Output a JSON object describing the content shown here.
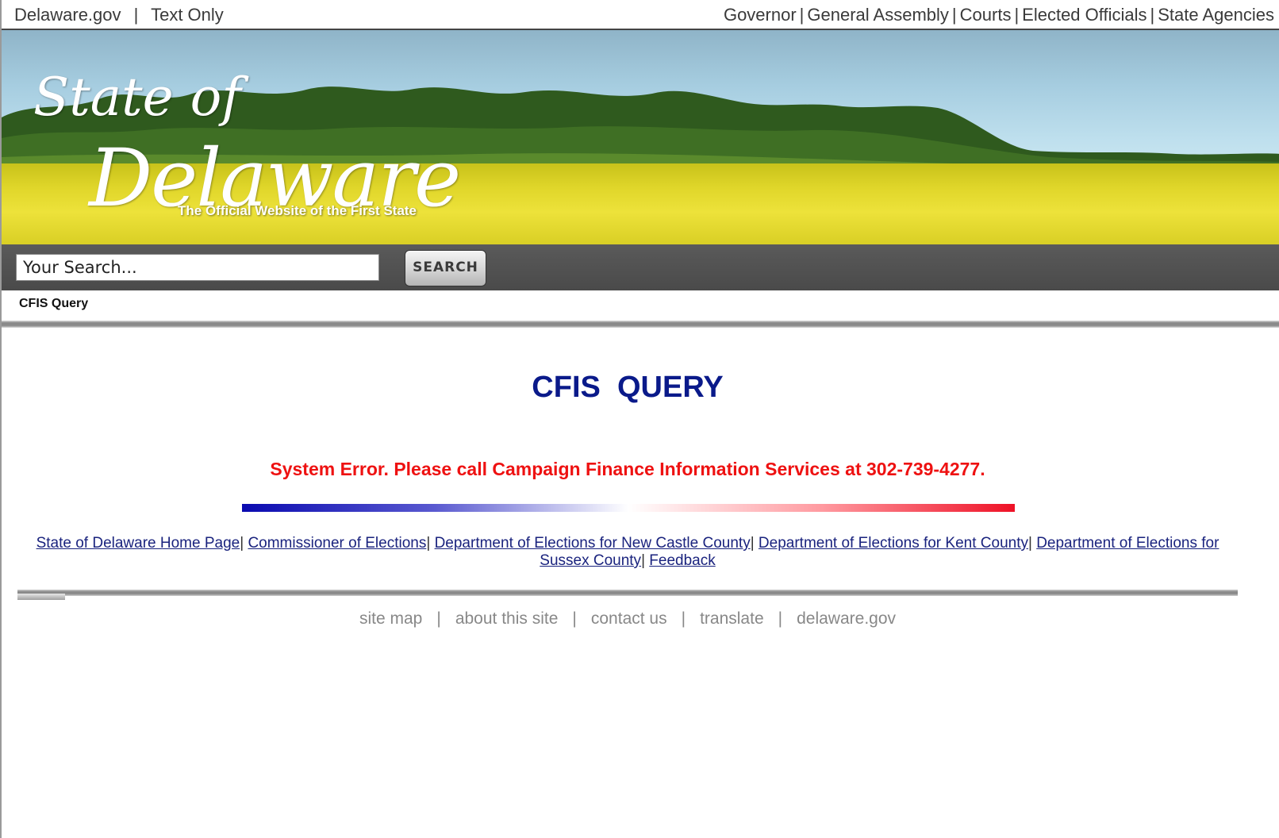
{
  "topbar": {
    "home_link": "Delaware.gov",
    "separator": "|",
    "text_only": "Text Only",
    "nav": [
      {
        "label": "Governor"
      },
      {
        "label": "General Assembly"
      },
      {
        "label": "Courts"
      },
      {
        "label": "Elected Officials"
      },
      {
        "label": "State Agencies"
      }
    ]
  },
  "banner": {
    "logo_line1": "State of",
    "logo_line2": "Delaware",
    "tagline": "The Official Website of the First State"
  },
  "search": {
    "placeholder": "Your Search...",
    "button_label": "SEARCH"
  },
  "breadcrumb": "CFIS Query",
  "main": {
    "title": "CFIS  QUERY",
    "error_message": "System Error. Please call Campaign Finance Information Services at 302-739-4277."
  },
  "links": [
    {
      "label": "State of Delaware Home Page"
    },
    {
      "label": "Commissioner of Elections"
    },
    {
      "label": "Department of Elections for New Castle County"
    },
    {
      "label": "Department of Elections for Kent County"
    },
    {
      "label": "Department of Elections for Sussex County"
    },
    {
      "label": "Feedback"
    }
  ],
  "link_separator": "|",
  "footer": {
    "links": [
      {
        "label": "site map"
      },
      {
        "label": "about this site"
      },
      {
        "label": "contact us"
      },
      {
        "label": "translate"
      },
      {
        "label": "delaware.gov"
      }
    ],
    "separator": "|"
  },
  "colors": {
    "title": "#0a1a8a",
    "error": "#ee1111",
    "link": "#1a237e",
    "footer_text": "#888888"
  }
}
